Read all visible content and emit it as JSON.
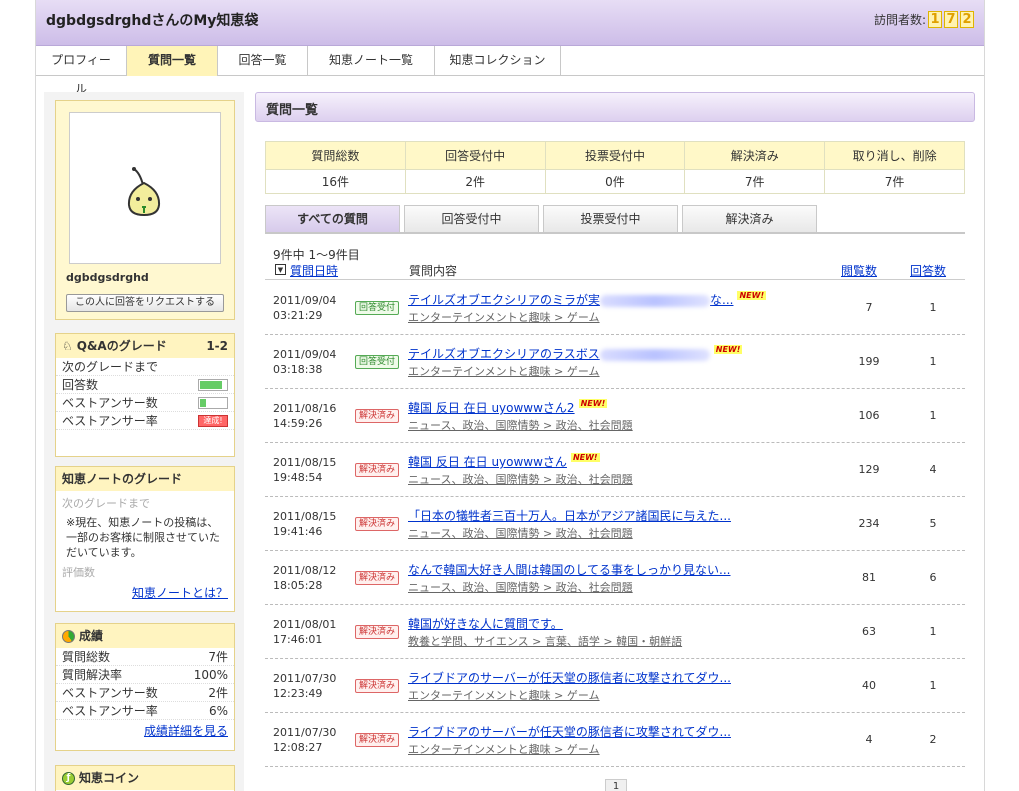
{
  "header": {
    "title": "dgbdgsdrghdさんのMy知恵袋",
    "visitors_label": "訪問者数:",
    "visitor_digits": [
      "1",
      "7",
      "2"
    ]
  },
  "tabs": [
    {
      "label": "プロフィール",
      "active": false
    },
    {
      "label": "質問一覧",
      "active": true
    },
    {
      "label": "回答一覧",
      "active": false
    },
    {
      "label": "知恵ノート一覧",
      "active": false
    },
    {
      "label": "知恵コレクション",
      "active": false
    }
  ],
  "profile": {
    "username": "dgbdgsdrghd",
    "request_button": "この人に回答をリクエストする"
  },
  "qa_grade": {
    "title": "Q&Aのグレード",
    "grade": "1-2",
    "next_label": "次のグレードまで",
    "rows": [
      {
        "label": "回答数",
        "progress": 0.8,
        "gauge": "green"
      },
      {
        "label": "ベストアンサー数",
        "progress": 0.2,
        "gauge": "green"
      },
      {
        "label": "ベストアンサー率",
        "status": "達成!",
        "gauge": "red"
      }
    ]
  },
  "note_grade": {
    "title": "知恵ノートのグレード",
    "next_label": "次のグレードまで",
    "notice": "※現在、知恵ノートの投稿は、一部のお客様に制限させていただいています。",
    "eval_label": "評価数",
    "link": "知恵ノートとは？"
  },
  "results": {
    "title": "成績",
    "rows": [
      {
        "label": "質問総数",
        "value": "7件"
      },
      {
        "label": "質問解決率",
        "value": "100%"
      },
      {
        "label": "ベストアンサー数",
        "value": "2件"
      },
      {
        "label": "ベストアンサー率",
        "value": "6%"
      }
    ],
    "link": "成績詳細を見る"
  },
  "coin": {
    "title": "知恵コイン"
  },
  "main": {
    "title": "質問一覧",
    "stats": [
      {
        "label": "質問総数",
        "value": "16件"
      },
      {
        "label": "回答受付中",
        "value": "2件"
      },
      {
        "label": "投票受付中",
        "value": "0件"
      },
      {
        "label": "解決済み",
        "value": "7件"
      },
      {
        "label": "取り消し、削除",
        "value": "7件"
      }
    ],
    "subtabs": [
      {
        "label": "すべての質問",
        "active": true
      },
      {
        "label": "回答受付中",
        "active": false
      },
      {
        "label": "投票受付中",
        "active": false
      },
      {
        "label": "解決済み",
        "active": false
      }
    ],
    "count_text": "9件中 1〜9件目",
    "columns": {
      "date": "質問日時",
      "content": "質問内容",
      "views": "閲覧数",
      "answers": "回答数"
    },
    "new_label": "NEW!",
    "rows": [
      {
        "date": "2011/09/04",
        "time": "03:21:29",
        "status": "回答受付",
        "status_type": "open",
        "title_pre": "テイルズオブエクシリアのミラが実",
        "blurred": true,
        "title_post": "な...",
        "is_new": true,
        "category": "エンターテインメントと趣味 > ゲーム",
        "views": "7",
        "answers": "1"
      },
      {
        "date": "2011/09/04",
        "time": "03:18:38",
        "status": "回答受付",
        "status_type": "open",
        "title_pre": "テイルズオブエクシリアのラスボス",
        "blurred": true,
        "title_post": "",
        "is_new": true,
        "category": "エンターテインメントと趣味 > ゲーム",
        "views": "199",
        "answers": "1"
      },
      {
        "date": "2011/08/16",
        "time": "14:59:26",
        "status": "解決済み",
        "status_type": "done",
        "title_pre": "韓国 反日 在日 uyowwwさん2",
        "blurred": false,
        "title_post": "",
        "is_new": true,
        "category": "ニュース、政治、国際情勢 > 政治、社会問題",
        "views": "106",
        "answers": "1"
      },
      {
        "date": "2011/08/15",
        "time": "19:48:54",
        "status": "解決済み",
        "status_type": "done",
        "title_pre": "韓国 反日 在日 uyowwwさん",
        "blurred": false,
        "title_post": "",
        "is_new": true,
        "category": "ニュース、政治、国際情勢 > 政治、社会問題",
        "views": "129",
        "answers": "4"
      },
      {
        "date": "2011/08/15",
        "time": "19:41:46",
        "status": "解決済み",
        "status_type": "done",
        "title_pre": "「日本の犠牲者三百十万人。日本がアジア諸国民に与えた...",
        "blurred": false,
        "title_post": "",
        "is_new": false,
        "category": "ニュース、政治、国際情勢 > 政治、社会問題",
        "views": "234",
        "answers": "5"
      },
      {
        "date": "2011/08/12",
        "time": "18:05:28",
        "status": "解決済み",
        "status_type": "done",
        "title_pre": "なんで韓国大好き人間は韓国のしてる事をしっかり見ない...",
        "blurred": false,
        "title_post": "",
        "is_new": false,
        "category": "ニュース、政治、国際情勢 > 政治、社会問題",
        "views": "81",
        "answers": "6"
      },
      {
        "date": "2011/08/01",
        "time": "17:46:01",
        "status": "解決済み",
        "status_type": "done",
        "title_pre": "韓国が好きな人に質問です。",
        "blurred": false,
        "title_post": "",
        "is_new": false,
        "category": "教養と学問、サイエンス > 言葉、語学 > 韓国・朝鮮語",
        "views": "63",
        "answers": "1"
      },
      {
        "date": "2011/07/30",
        "time": "12:23:49",
        "status": "解決済み",
        "status_type": "done",
        "title_pre": "ライブドアのサーバーが任天堂の豚信者に攻撃されてダウ...",
        "blurred": false,
        "title_post": "",
        "is_new": false,
        "category": "エンターテインメントと趣味 > ゲーム",
        "views": "40",
        "answers": "1"
      },
      {
        "date": "2011/07/30",
        "time": "12:08:27",
        "status": "解決済み",
        "status_type": "done",
        "title_pre": "ライブドアのサーバーが任天堂の豚信者に攻撃されてダウ...",
        "blurred": false,
        "title_post": "",
        "is_new": false,
        "category": "エンターテインメントと趣味 > ゲーム",
        "views": "4",
        "answers": "2"
      }
    ],
    "pager": "1"
  }
}
